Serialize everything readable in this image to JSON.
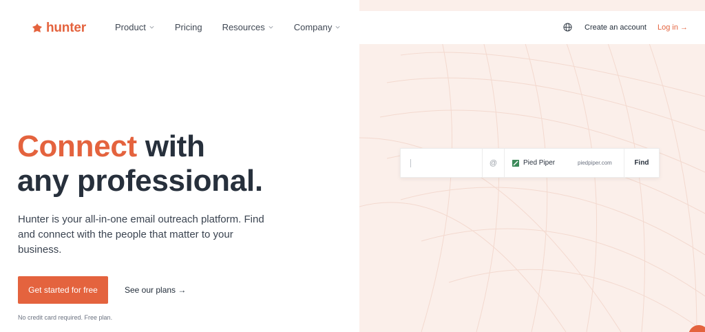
{
  "brand": {
    "name": "hunter",
    "accent_color": "#e4633e",
    "dark_text": "#27303c",
    "panel_bg": "#fbefea"
  },
  "nav": {
    "items": [
      {
        "label": "Product",
        "has_dropdown": true
      },
      {
        "label": "Pricing",
        "has_dropdown": false
      },
      {
        "label": "Resources",
        "has_dropdown": true
      },
      {
        "label": "Company",
        "has_dropdown": true
      }
    ],
    "language_icon": "globe-icon",
    "create_account": "Create an account",
    "login": "Log in →"
  },
  "hero": {
    "headline_accent": "Connect",
    "headline_rest_1": " with",
    "headline_line_2": "any professional.",
    "subtext": "Hunter is your all-in-one email outreach platform. Find and connect with the people that matter to your business.",
    "cta_label": "Get started for free",
    "plans_link": "See our plans →",
    "fineprint": "No credit card required. Free plan."
  },
  "finder": {
    "name_value": "",
    "at_symbol": "@",
    "company_name": "Pied Piper",
    "company_domain": "piedpiper.com",
    "button_label": "Find"
  }
}
